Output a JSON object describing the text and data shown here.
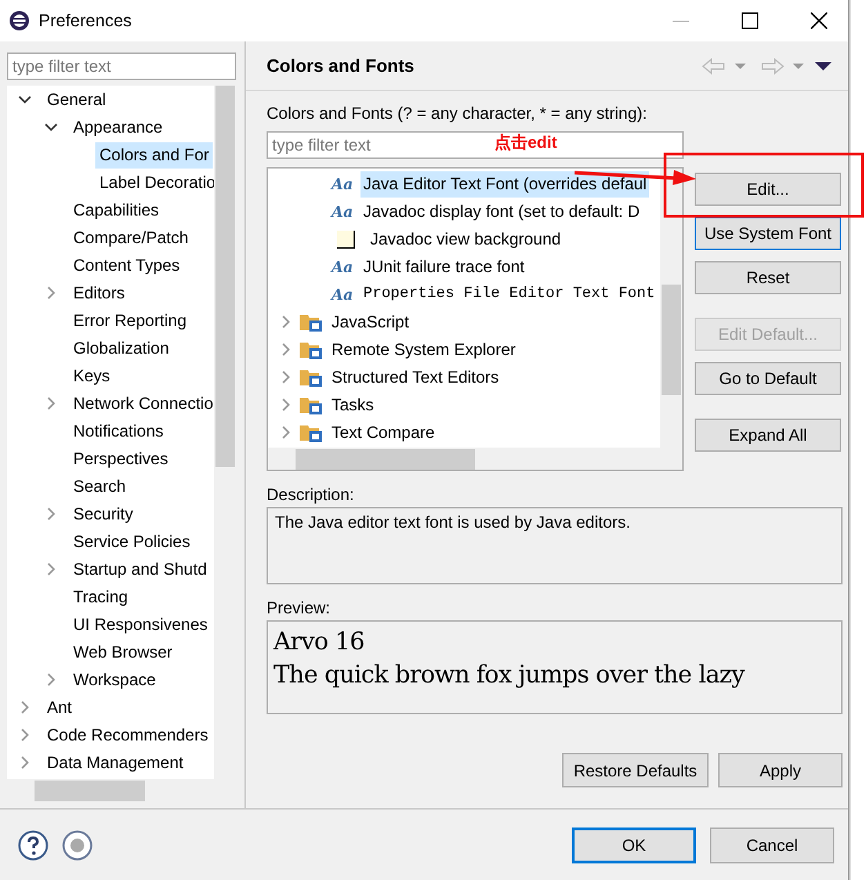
{
  "window": {
    "title": "Preferences"
  },
  "sidebar": {
    "filter": {
      "placeholder": "type filter text"
    },
    "items": [
      {
        "label": "General",
        "expanded": true,
        "selected": false,
        "children": [
          {
            "label": "Appearance",
            "expanded": true,
            "selected": false,
            "children": [
              {
                "label": "Colors and For",
                "selected": true
              },
              {
                "label": "Label Decoratio",
                "selected": false
              }
            ]
          },
          {
            "label": "Capabilities",
            "selected": false
          },
          {
            "label": "Compare/Patch",
            "selected": false
          },
          {
            "label": "Content Types",
            "selected": false
          },
          {
            "label": "Editors",
            "expanded": false,
            "selected": false
          },
          {
            "label": "Error Reporting",
            "selected": false
          },
          {
            "label": "Globalization",
            "selected": false
          },
          {
            "label": "Keys",
            "selected": false
          },
          {
            "label": "Network Connectio",
            "expanded": false,
            "selected": false
          },
          {
            "label": "Notifications",
            "selected": false
          },
          {
            "label": "Perspectives",
            "selected": false
          },
          {
            "label": "Search",
            "selected": false
          },
          {
            "label": "Security",
            "expanded": false,
            "selected": false
          },
          {
            "label": "Service Policies",
            "selected": false
          },
          {
            "label": "Startup and Shutd",
            "expanded": false,
            "selected": false
          },
          {
            "label": "Tracing",
            "selected": false
          },
          {
            "label": "UI Responsivenes",
            "selected": false
          },
          {
            "label": "Web Browser",
            "selected": false
          },
          {
            "label": "Workspace",
            "expanded": false,
            "selected": false
          }
        ]
      },
      {
        "label": "Ant",
        "expanded": false,
        "selected": false
      },
      {
        "label": "Code Recommenders",
        "expanded": false,
        "selected": false
      },
      {
        "label": "Data Management",
        "expanded": false,
        "selected": false
      }
    ]
  },
  "page": {
    "title": "Colors and Fonts",
    "filter_label": "Colors and Fonts (? = any character, * = any string):",
    "filter": {
      "placeholder": "type filter text"
    },
    "rows": [
      {
        "kind": "font",
        "icon": "Aa",
        "label": "Java Editor Text Font (overrides defaul",
        "selected": true,
        "mono": false
      },
      {
        "kind": "font",
        "icon": "Aa",
        "label": "Javadoc display font (set to default: D",
        "selected": false,
        "mono": false
      },
      {
        "kind": "color",
        "label": "Javadoc view background",
        "selected": false,
        "color": "#fffbe0"
      },
      {
        "kind": "font",
        "icon": "Aa",
        "label": "JUnit failure trace font",
        "selected": false,
        "mono": false
      },
      {
        "kind": "font",
        "icon": "Aa",
        "label": "Properties File Editor Text Font",
        "selected": false,
        "mono": true
      },
      {
        "kind": "category",
        "label": "JavaScript",
        "selected": false,
        "expanded": false
      },
      {
        "kind": "category",
        "label": "Remote System Explorer",
        "selected": false,
        "expanded": false
      },
      {
        "kind": "category",
        "label": "Structured Text Editors",
        "selected": false,
        "expanded": false
      },
      {
        "kind": "category",
        "label": "Tasks",
        "selected": false,
        "expanded": false
      },
      {
        "kind": "category",
        "label": "Text Compare",
        "selected": false,
        "expanded": false
      }
    ],
    "side_button_groups": [
      [
        {
          "label": "Edit...",
          "disabled": false,
          "focused": false
        },
        {
          "label": "Use System Font",
          "disabled": false,
          "focused": true
        },
        {
          "label": "Reset",
          "disabled": false,
          "focused": false
        }
      ],
      [
        {
          "label": "Edit Default...",
          "disabled": true,
          "focused": false
        },
        {
          "label": "Go to Default",
          "disabled": false,
          "focused": false
        }
      ],
      [
        {
          "label": "Expand All",
          "disabled": false,
          "focused": false
        }
      ]
    ],
    "description_label": "Description:",
    "description": "The Java editor text font is used by Java editors.",
    "preview_label": "Preview:",
    "preview": [
      "Arvo 16",
      "The quick brown fox jumps over the lazy"
    ],
    "buttons": [
      "Restore Defaults",
      "Apply"
    ]
  },
  "annotation": {
    "text": "点击edit"
  },
  "footer": {
    "buttons": [
      {
        "label": "OK",
        "default": true
      },
      {
        "label": "Cancel",
        "default": false
      }
    ]
  }
}
